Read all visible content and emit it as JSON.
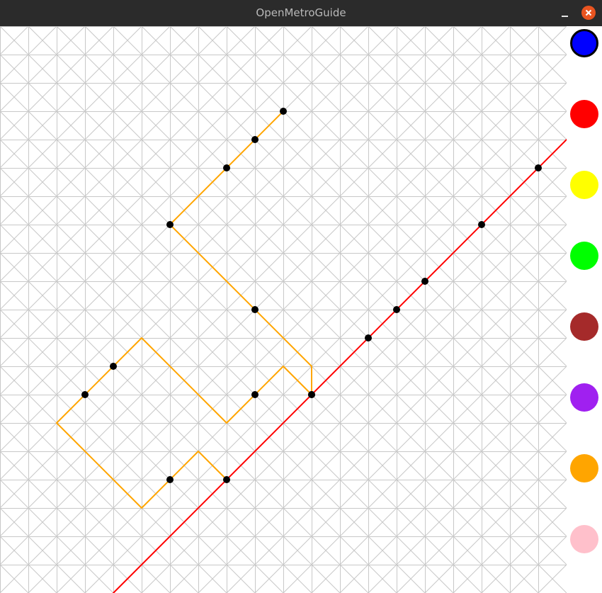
{
  "window": {
    "title": "OpenMetroGuide"
  },
  "colors": {
    "titlebar_bg": "#2b2b2b",
    "grid_line": "#c8c8c8",
    "close_button": "#e95420",
    "station_fill": "#000000"
  },
  "palette": {
    "selected": "blue",
    "swatches": [
      {
        "name": "blue",
        "color": "#0000ff"
      },
      {
        "name": "red",
        "color": "#ff0000"
      },
      {
        "name": "yellow",
        "color": "#ffff00"
      },
      {
        "name": "green",
        "color": "#00ff00"
      },
      {
        "name": "brown",
        "color": "#a52a2a"
      },
      {
        "name": "purple",
        "color": "#a020f0"
      },
      {
        "name": "orange",
        "color": "#ffa500"
      },
      {
        "name": "pink",
        "color": "#ffc0cb"
      }
    ]
  },
  "map": {
    "grid": {
      "columns": 20,
      "rows": 20
    },
    "lines": [
      {
        "name": "red",
        "color": "#ff0000",
        "route": [
          [
            4,
            20
          ],
          [
            20,
            4
          ]
        ],
        "stations": [
          [
            19,
            5
          ],
          [
            17,
            7
          ],
          [
            15,
            9
          ],
          [
            14,
            10
          ],
          [
            13,
            11
          ],
          [
            11,
            13
          ],
          [
            8,
            16
          ]
        ]
      },
      {
        "name": "orange",
        "color": "#ffa500",
        "route": [
          [
            10,
            3
          ],
          [
            6,
            7
          ],
          [
            11,
            12
          ],
          [
            11,
            13
          ],
          [
            10,
            12
          ],
          [
            8,
            14
          ],
          [
            5,
            11
          ],
          [
            2,
            14
          ],
          [
            5,
            17
          ],
          [
            7,
            15
          ],
          [
            8,
            16
          ]
        ],
        "stations": [
          [
            10,
            3
          ],
          [
            9,
            4
          ],
          [
            8,
            5
          ],
          [
            6,
            7
          ],
          [
            9,
            10
          ],
          [
            11,
            13
          ],
          [
            9,
            13
          ],
          [
            4,
            12
          ],
          [
            3,
            13
          ],
          [
            6,
            16
          ]
        ]
      }
    ]
  }
}
